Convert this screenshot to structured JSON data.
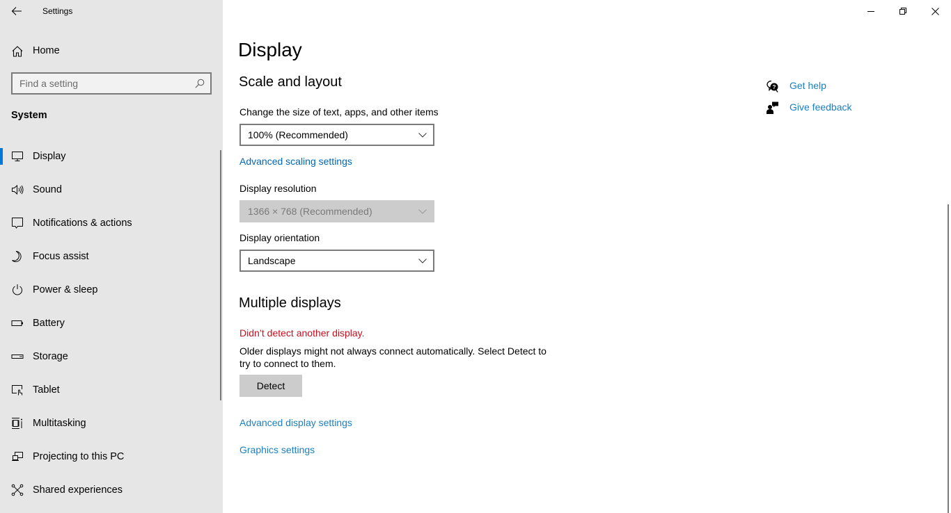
{
  "window": {
    "title": "Settings",
    "controls": {
      "minimize": "minimize-icon",
      "restore": "restore-icon",
      "close": "close-icon"
    }
  },
  "sidebar": {
    "back_icon": "arrow-left-icon",
    "home_label": "Home",
    "search_placeholder": "Find a setting",
    "search_value": "",
    "section": "System",
    "items": [
      {
        "label": "Display",
        "icon": "monitor-icon",
        "selected": true
      },
      {
        "label": "Sound",
        "icon": "speaker-icon",
        "selected": false
      },
      {
        "label": "Notifications & actions",
        "icon": "notification-icon",
        "selected": false
      },
      {
        "label": "Focus assist",
        "icon": "moon-icon",
        "selected": false
      },
      {
        "label": "Power & sleep",
        "icon": "power-icon",
        "selected": false
      },
      {
        "label": "Battery",
        "icon": "battery-icon",
        "selected": false
      },
      {
        "label": "Storage",
        "icon": "storage-icon",
        "selected": false
      },
      {
        "label": "Tablet",
        "icon": "tablet-icon",
        "selected": false
      },
      {
        "label": "Multitasking",
        "icon": "multitasking-icon",
        "selected": false
      },
      {
        "label": "Projecting to this PC",
        "icon": "projecting-icon",
        "selected": false
      },
      {
        "label": "Shared experiences",
        "icon": "shared-icon",
        "selected": false
      }
    ]
  },
  "main": {
    "title": "Display",
    "scale_layout": {
      "heading": "Scale and layout",
      "size_label": "Change the size of text, apps, and other items",
      "size_value": "100% (Recommended)",
      "advanced_scaling_link": "Advanced scaling settings",
      "resolution_label": "Display resolution",
      "resolution_value": "1366 × 768 (Recommended)",
      "orientation_label": "Display orientation",
      "orientation_value": "Landscape"
    },
    "multiple_displays": {
      "heading": "Multiple displays",
      "error": "Didn’t detect another display.",
      "description": "Older displays might not always connect automatically. Select Detect to try to connect to them.",
      "detect_button": "Detect",
      "advanced_display_link": "Advanced display settings",
      "graphics_link": "Graphics settings"
    },
    "help": {
      "get_help": "Get help",
      "give_feedback": "Give feedback"
    }
  },
  "colors": {
    "accent": "#0078d7",
    "link": "#0067b8",
    "error": "#c50f1f",
    "sidebar_bg": "#e6e6e6"
  }
}
